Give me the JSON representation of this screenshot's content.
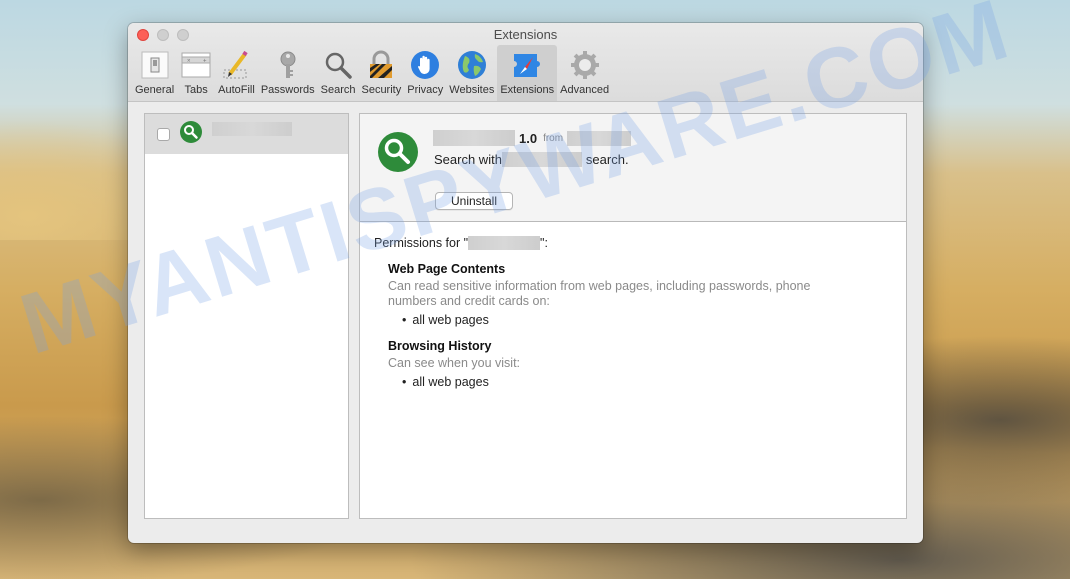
{
  "window": {
    "title": "Extensions"
  },
  "toolbar": {
    "items": [
      {
        "label": "General",
        "icon": "general-switch-icon"
      },
      {
        "label": "Tabs",
        "icon": "tabs-icon"
      },
      {
        "label": "AutoFill",
        "icon": "pencil-icon"
      },
      {
        "label": "Passwords",
        "icon": "key-icon"
      },
      {
        "label": "Search",
        "icon": "magnifier-icon"
      },
      {
        "label": "Security",
        "icon": "padlock-icon"
      },
      {
        "label": "Privacy",
        "icon": "hand-icon"
      },
      {
        "label": "Websites",
        "icon": "globe-icon"
      },
      {
        "label": "Extensions",
        "icon": "puzzle-compass-icon",
        "active": true
      },
      {
        "label": "Advanced",
        "icon": "gear-icon"
      }
    ]
  },
  "extension_list": {
    "items": [
      {
        "name": "",
        "enabled": false,
        "selected": true
      }
    ]
  },
  "detail": {
    "version": "1.0",
    "from_label": "from",
    "description_prefix": "Search with",
    "description_suffix": "search.",
    "uninstall_label": "Uninstall",
    "permissions_prefix": "Permissions for \"",
    "permissions_suffix": "\":",
    "sections": [
      {
        "title": "Web Page Contents",
        "description": "Can read sensitive information from web pages, including passwords, phone numbers and credit cards on:",
        "items": [
          "all web pages"
        ]
      },
      {
        "title": "Browsing History",
        "description": "Can see when you visit:",
        "items": [
          "all web pages"
        ]
      }
    ]
  },
  "watermark": "MYANTISPYWARE.COM",
  "colors": {
    "accent_green": "#2e8b3a",
    "close_red": "#fc5f57"
  }
}
